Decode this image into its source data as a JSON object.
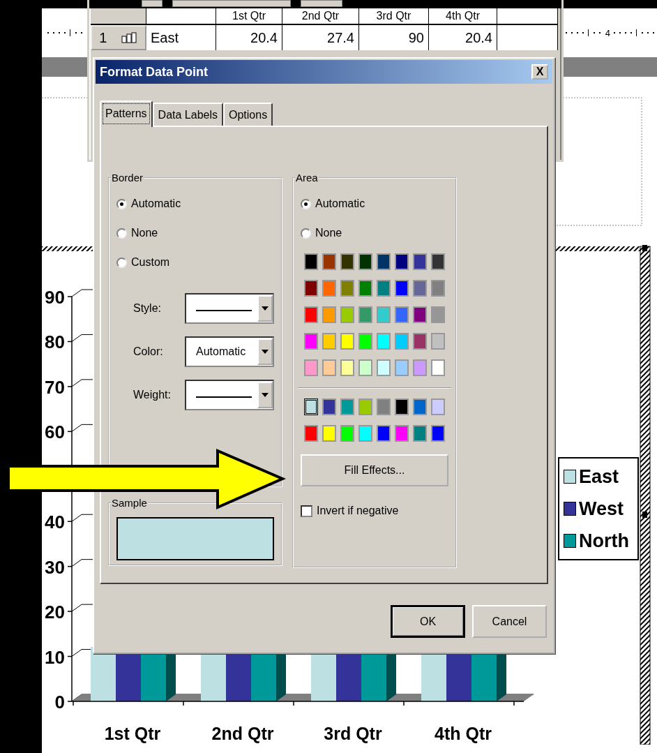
{
  "datasheet": {
    "columns": [
      "1st Qtr",
      "2nd Qtr",
      "3rd Qtr",
      "4th Qtr"
    ],
    "rows": [
      {
        "number": "1",
        "label": "East",
        "values": [
          "20.4",
          "27.4",
          "90",
          "20.4"
        ]
      }
    ]
  },
  "ruler": {
    "number": "4"
  },
  "chart": {
    "y_axis_labels": [
      "90",
      "80",
      "70",
      "60",
      "40",
      "30",
      "20",
      "10",
      "0"
    ],
    "categories": [
      "1st Qtr",
      "2nd Qtr",
      "3rd Qtr",
      "4th Qtr"
    ],
    "series": [
      {
        "name": "East",
        "color": "#bde0e3"
      },
      {
        "name": "West",
        "color": "#333399"
      },
      {
        "name": "North",
        "color": "#009999"
      }
    ]
  },
  "dialog": {
    "title": "Format Data Point",
    "close": "X",
    "tabs": [
      {
        "label": "Patterns",
        "selected": true
      },
      {
        "label": "Data Labels",
        "selected": false
      },
      {
        "label": "Options",
        "selected": false
      }
    ],
    "border": {
      "legend": "Border",
      "options": [
        {
          "label": "Automatic",
          "selected": true
        },
        {
          "label": "None",
          "selected": false
        },
        {
          "label": "Custom",
          "selected": false
        }
      ],
      "fields": [
        {
          "label": "Style:",
          "kind": "line"
        },
        {
          "label": "Color:",
          "kind": "text",
          "value": "Automatic"
        },
        {
          "label": "Weight:",
          "kind": "line"
        }
      ]
    },
    "sample": {
      "legend": "Sample"
    },
    "area": {
      "legend": "Area",
      "options": [
        {
          "label": "Automatic",
          "selected": true
        },
        {
          "label": "None",
          "selected": false
        }
      ],
      "standard_colors": [
        {
          "color": "#000000",
          "selected": false
        },
        {
          "color": "#993300",
          "selected": false
        },
        {
          "color": "#333300",
          "selected": false
        },
        {
          "color": "#003300",
          "selected": false
        },
        {
          "color": "#003366",
          "selected": false
        },
        {
          "color": "#000080",
          "selected": false
        },
        {
          "color": "#333399",
          "selected": false
        },
        {
          "color": "#333333",
          "selected": false
        },
        {
          "color": "#800000",
          "selected": false
        },
        {
          "color": "#ff6600",
          "selected": false
        },
        {
          "color": "#808000",
          "selected": false
        },
        {
          "color": "#008000",
          "selected": false
        },
        {
          "color": "#008080",
          "selected": false
        },
        {
          "color": "#0000ff",
          "selected": false
        },
        {
          "color": "#666699",
          "selected": false
        },
        {
          "color": "#808080",
          "selected": false
        },
        {
          "color": "#ff0000",
          "selected": false
        },
        {
          "color": "#ff9900",
          "selected": false
        },
        {
          "color": "#99cc00",
          "selected": false
        },
        {
          "color": "#339966",
          "selected": false
        },
        {
          "color": "#33cccc",
          "selected": false
        },
        {
          "color": "#3366ff",
          "selected": false
        },
        {
          "color": "#800080",
          "selected": false
        },
        {
          "color": "#969696",
          "selected": false
        },
        {
          "color": "#ff00ff",
          "selected": false
        },
        {
          "color": "#ffcc00",
          "selected": false
        },
        {
          "color": "#ffff00",
          "selected": false
        },
        {
          "color": "#00ff00",
          "selected": false
        },
        {
          "color": "#00ffff",
          "selected": false
        },
        {
          "color": "#00ccff",
          "selected": false
        },
        {
          "color": "#993366",
          "selected": false
        },
        {
          "color": "#c0c0c0",
          "selected": false
        },
        {
          "color": "#ff99cc",
          "selected": false
        },
        {
          "color": "#ffcc99",
          "selected": false
        },
        {
          "color": "#ffff99",
          "selected": false
        },
        {
          "color": "#ccffcc",
          "selected": false
        },
        {
          "color": "#ccffff",
          "selected": false
        },
        {
          "color": "#99ccff",
          "selected": false
        },
        {
          "color": "#cc99ff",
          "selected": false
        },
        {
          "color": "#ffffff",
          "selected": false
        }
      ],
      "chart_colors": [
        {
          "color": "#bde0e3",
          "selected": true
        },
        {
          "color": "#333399",
          "selected": false
        },
        {
          "color": "#009999",
          "selected": false
        },
        {
          "color": "#99cc00",
          "selected": false
        },
        {
          "color": "#808080",
          "selected": false
        },
        {
          "color": "#000000",
          "selected": false
        },
        {
          "color": "#0066cc",
          "selected": false
        },
        {
          "color": "#ccccff",
          "selected": false
        },
        {
          "color": "#ff0000",
          "selected": false
        },
        {
          "color": "#ffff00",
          "selected": false
        },
        {
          "color": "#00ff00",
          "selected": false
        },
        {
          "color": "#00ffff",
          "selected": false
        },
        {
          "color": "#0000ff",
          "selected": false
        },
        {
          "color": "#ff00ff",
          "selected": false
        },
        {
          "color": "#008080",
          "selected": false
        },
        {
          "color": "#0000ff",
          "selected": false
        }
      ],
      "fill_effects": "Fill Effects...",
      "invert": {
        "label": "Invert if negative",
        "checked": false
      }
    },
    "buttons": [
      {
        "label": "OK",
        "default": true
      },
      {
        "label": "Cancel",
        "default": false
      }
    ]
  }
}
